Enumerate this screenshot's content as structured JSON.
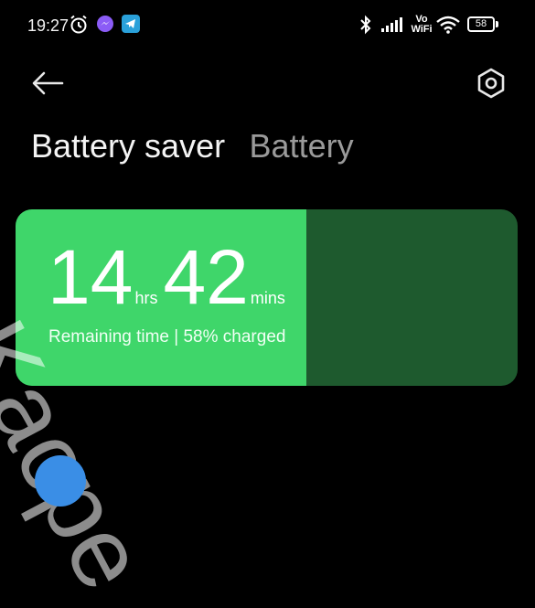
{
  "status_bar": {
    "time": "19:27",
    "notification_icons": [
      "alarm-icon",
      "messenger-icon",
      "telegram-icon"
    ],
    "system_icons": [
      "bluetooth-icon",
      "signal-icon",
      "vowifi-icon",
      "wifi-icon",
      "battery-icon"
    ],
    "vowifi_top": "Vo",
    "vowifi_bottom": "WiFi",
    "battery_level": "58"
  },
  "header": {
    "back_icon": "arrow-left-icon",
    "settings_icon": "hexagon-gear-icon"
  },
  "tabs": [
    {
      "label": "Battery saver",
      "active": true
    },
    {
      "label": "Battery",
      "active": false
    }
  ],
  "battery_card": {
    "hours": "14",
    "hours_unit": "hrs",
    "minutes": "42",
    "minutes_unit": "mins",
    "caption": "Remaining time | 58% charged",
    "charge_fraction": 0.58,
    "fill_color": "#3fd66a",
    "empty_color": "#1e5a2e"
  },
  "watermark": {
    "text": "Kacpe"
  },
  "colors": {
    "background": "#000000",
    "accent_green": "#3fd66a"
  }
}
